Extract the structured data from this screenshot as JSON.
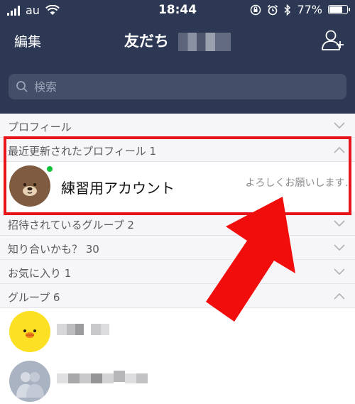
{
  "status_bar": {
    "carrier": "au",
    "time": "18:44",
    "battery": "77%",
    "battery_level": 0.77
  },
  "nav": {
    "edit_label": "編集",
    "title": "友だち"
  },
  "search": {
    "placeholder": "検索"
  },
  "sections": {
    "profile": "プロフィール",
    "recent": "最近更新されたプロフィール 1",
    "invited": "招待されているグループ 2",
    "know": "知り合いかも？ 30",
    "favorites": "お気に入り 1",
    "groups": "グループ 6"
  },
  "recent_friend": {
    "name": "練習用アカウント",
    "status": "よろしくお願いします."
  },
  "colors": {
    "header": "#2d3954",
    "highlight": "#e8141c",
    "online": "#10c13a"
  }
}
